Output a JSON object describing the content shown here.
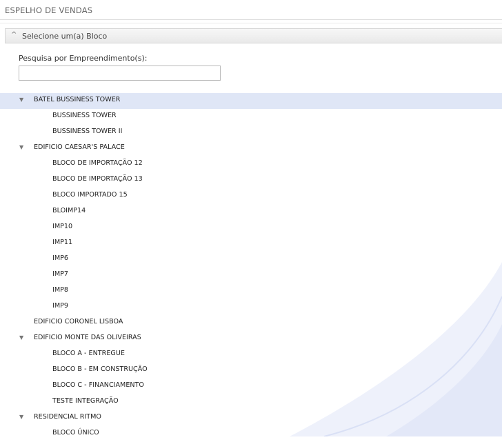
{
  "page": {
    "title": "ESPELHO DE VENDAS"
  },
  "panel": {
    "header_label": "Selecione um(a) Bloco"
  },
  "search": {
    "label": "Pesquisa por Empreendimento(s):",
    "value": "",
    "placeholder": ""
  },
  "tree": [
    {
      "type": "parent",
      "label": "BATEL BUSSINESS TOWER",
      "expanded": true,
      "selected": true
    },
    {
      "type": "child",
      "label": "BUSSINESS TOWER"
    },
    {
      "type": "child",
      "label": "BUSSINESS TOWER II"
    },
    {
      "type": "parent",
      "label": "EDIFICIO CAESAR'S PALACE",
      "expanded": true
    },
    {
      "type": "child",
      "label": "BLOCO DE IMPORTAÇÃO 12"
    },
    {
      "type": "child",
      "label": "BLOCO DE IMPORTAÇÃO 13"
    },
    {
      "type": "child",
      "label": "BLOCO IMPORTADO 15"
    },
    {
      "type": "child",
      "label": "BLOIMP14"
    },
    {
      "type": "child",
      "label": "IMP10"
    },
    {
      "type": "child",
      "label": "IMP11"
    },
    {
      "type": "child",
      "label": "IMP6"
    },
    {
      "type": "child",
      "label": "IMP7"
    },
    {
      "type": "child",
      "label": "IMP8"
    },
    {
      "type": "child",
      "label": "IMP9"
    },
    {
      "type": "leaf",
      "label": "EDIFICIO CORONEL LISBOA"
    },
    {
      "type": "parent",
      "label": "EDIFICIO MONTE DAS OLIVEIRAS",
      "expanded": true
    },
    {
      "type": "child",
      "label": "BLOCO A - ENTREGUE"
    },
    {
      "type": "child",
      "label": "BLOCO B - EM CONSTRUÇÃO"
    },
    {
      "type": "child",
      "label": "BLOCO C - FINANCIAMENTO"
    },
    {
      "type": "child",
      "label": "TESTE INTEGRAÇÃO"
    },
    {
      "type": "parent",
      "label": "RESIDENCIAL RITMO",
      "expanded": true
    },
    {
      "type": "child",
      "label": "BLOCO ÚNICO"
    }
  ],
  "colors": {
    "selected_row": "#dfe6f6",
    "header_bg": "#ececec"
  }
}
